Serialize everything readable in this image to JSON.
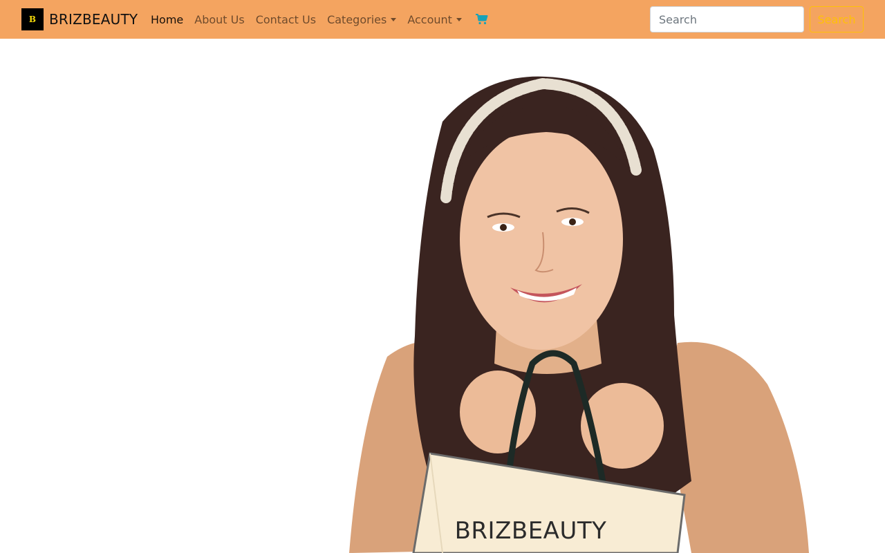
{
  "navbar": {
    "brand_name": "BRIZBEAUTY",
    "brand_logo_letter": "B",
    "links": [
      {
        "label": "Home",
        "active": true
      },
      {
        "label": "About Us",
        "active": false
      },
      {
        "label": "Contact Us",
        "active": false
      },
      {
        "label": "Categories",
        "dropdown": true
      },
      {
        "label": "Account",
        "dropdown": true
      }
    ],
    "cart_icon": "shopping-cart-icon",
    "search": {
      "placeholder": "Search",
      "button_label": "Search"
    }
  },
  "hero": {
    "caption": "BRIZBEAUTY",
    "image": "smiling-woman-holding-shopping-bag"
  },
  "colors": {
    "navbar_bg": "#f4a460",
    "search_button": "#ffc107",
    "cart_icon": "#17a2b8"
  }
}
